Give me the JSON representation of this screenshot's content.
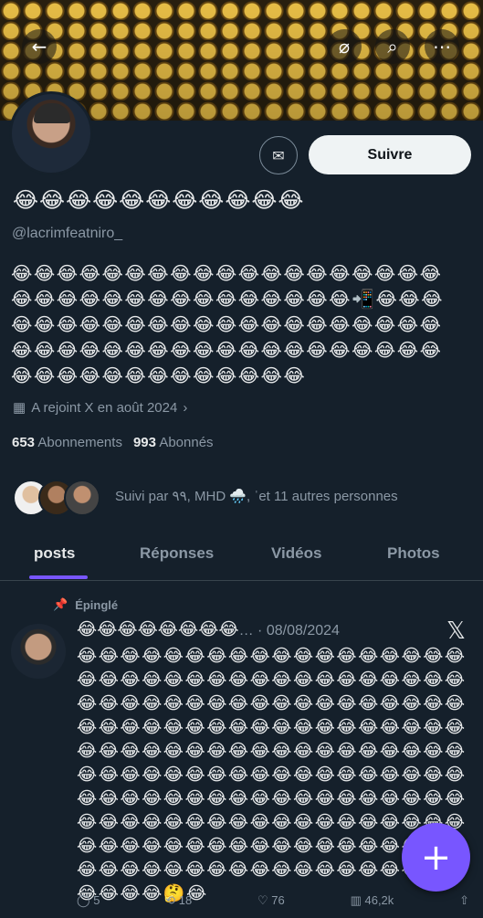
{
  "header": {
    "back_icon": "arrow-left-icon",
    "grok_icon": "grok-icon",
    "search_icon": "search-icon",
    "more_icon": "more-icon"
  },
  "profile": {
    "display_name": "😂😂😂😂😂😂😂😂😂😂😂",
    "handle": "@lacrimfeatniro_",
    "bio": "😂😂😂😂😂😂😂😂😂😂😂😂😂😂😂😂😂😂😂😂😂😂😂😂😂😂😂😂😂😂😂😂😂😂📲😂😂😂😂😂😂😂😂😂😂😂😂😂😂😂😂😂😂😂😂😂😂😂😂😂😂😂😂😂😂😂😂😂😂😂😂😂😂😂😂😂😂😂😂😂😂😂😂😂😂😂😂😂😂",
    "joined": "A rejoint X en août 2024",
    "following_count": "653",
    "following_label": "Abonnements",
    "followers_count": "993",
    "followers_label": "Abonnés",
    "followed_by": "Suivi par ٩٩, MHD 🌧️, ˈet 11 autres personnes"
  },
  "buttons": {
    "follow": "Suivre"
  },
  "tabs": [
    {
      "label": "posts"
    },
    {
      "label": "Réponses"
    },
    {
      "label": "Vidéos"
    },
    {
      "label": "Photos"
    }
  ],
  "post": {
    "pinned_label": "Épinglé",
    "head_emojis": "😂😂😂😂😂😂😂😂",
    "head_sep": "… · ",
    "date": "08/08/2024",
    "x_logo": "𝕏",
    "body": "😂😂😂😂😂😂😂😂😂😂😂😂😂😂😂😂😂😂😂😂😂😂😂😂😂😂😂😂😂😂😂😂😂😂😂😂😂😂😂😂😂😂😂😂😂😂😂😂😂😂😂😂😂😂😂😂😂😂😂😂😂😂😂😂😂😂😂😂😂😂😂😂😂😂😂😂😂😂😂😂😂😂😂😂😂😂😂😂😂😂😂😂😂😂😂😂😂😂😂😂😂😂😂😂😂😂😂😂😂😂😂😂😂😂😂😂😂😂😂😂😂😂😂😂😂😂😂😂😂😂😂😂😂😂😂😂😂😂😂😂😂😂😂😂😂😂😂😂😂😂😂😂😂😂😂😂😂😂😂😂😂😂😂😂😂😂😂😂😂😂😂😂😂😂😂😂😂😂😂😂😂😂😂😂🤔😂",
    "replies": "5",
    "reposts": "18",
    "likes": "76",
    "views": "46,2k"
  },
  "fab_icon": "plus-icon"
}
